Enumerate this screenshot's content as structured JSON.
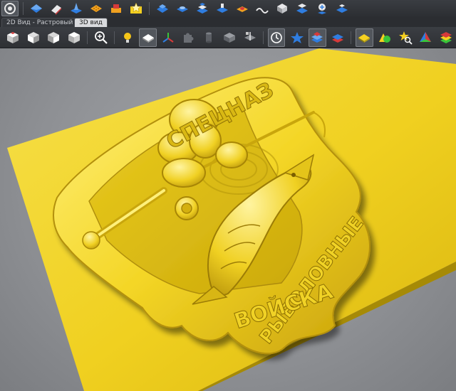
{
  "tabs": [
    {
      "label": "2D Вид - Растровый слой",
      "active": false
    },
    {
      "label": "3D вид",
      "active": true
    }
  ],
  "relief": {
    "arc_text": "СПЕЦНАЗ",
    "side_text": "РЫБОЛОВНЫЕ",
    "bottom_text": "ВОЙСКА"
  },
  "colors": {
    "accent_blue": "#2f7de0",
    "relief_yellow": "#f2d422",
    "toolbar_bg": "#2e3034",
    "viewport_bg": "#8e9094"
  },
  "toolbar_top_icons": [
    "app-logo-icon",
    "flat-relief-icon",
    "eraser-icon",
    "spike-relief-icon",
    "texture-relief-icon",
    "offset-relief-icon",
    "star-relief-icon",
    "raise-relief-icon",
    "smooth-relief-icon",
    "layered-relief-icon",
    "stamp-relief-icon",
    "crater-relief-icon",
    "wave-relief-icon",
    "cube-relief-icon",
    "move-relief-icon",
    "pin-relief-icon",
    "scale-relief-icon"
  ],
  "toolbar_view_icons": [
    "view-iso-icon",
    "view-front-icon",
    "view-side-icon",
    "view-top-icon",
    "zoom-icon",
    "light-icon",
    "material-plane-icon",
    "axes-icon",
    "puzzle-icon",
    "cylinder-icon",
    "box-icon",
    "section-icon",
    "clock-icon",
    "star-icon",
    "layers-icon",
    "layers-red-icon",
    "yellow-plane-icon",
    "shapes-icon",
    "search-star-icon",
    "pyramid-icon",
    "stack-icon"
  ]
}
